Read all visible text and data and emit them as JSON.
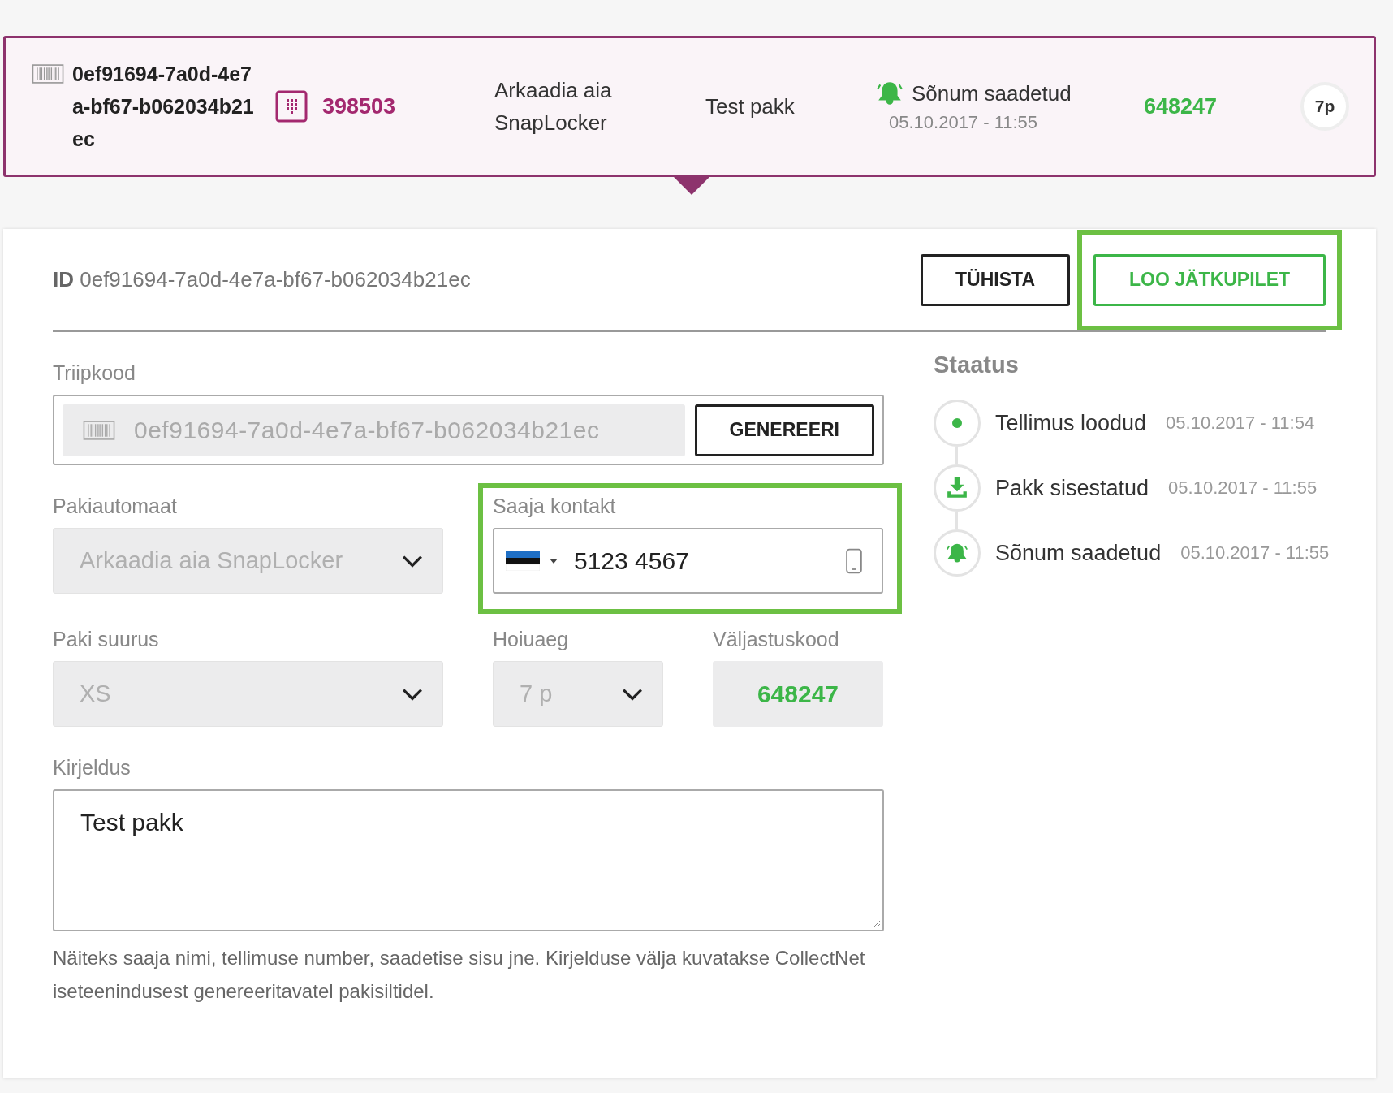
{
  "summary": {
    "barcode": "0ef91694-7a0d-4e7a-bf67-b062034b21ec",
    "pin": "398503",
    "locker": "Arkaadia aia SnapLocker",
    "description": "Test pakk",
    "status": "Sõnum saadetud",
    "status_time": "05.10.2017 - 11:55",
    "pickup_code": "648247",
    "storage_badge": "7p",
    "selected": true
  },
  "detail": {
    "id_label": "ID",
    "id": "0ef91694-7a0d-4e7a-bf67-b062034b21ec",
    "buttons": [
      {
        "label": "TÜHISTA",
        "kind": "outline",
        "highlighted": false
      },
      {
        "label": "LOO JÄTKUPILET",
        "kind": "primary",
        "highlighted": true
      }
    ],
    "barcode": {
      "label": "Triipkood",
      "value": "0ef91694-7a0d-4e7a-bf67-b062034b21ec",
      "button": "GENEREERI"
    },
    "locker": {
      "label": "Pakiautomaat",
      "value": "Arkaadia aia SnapLocker",
      "disabled": true
    },
    "contact": {
      "label": "Saaja kontakt",
      "value": "5123 4567",
      "highlighted": true
    },
    "size": {
      "label": "Paki suurus",
      "value": "XS",
      "disabled": true
    },
    "storage": {
      "label": "Hoiuaeg",
      "value": "7 p",
      "disabled": true
    },
    "pickup": {
      "label": "Väljastuskood",
      "value": "648247"
    },
    "description": {
      "label": "Kirjeldus",
      "value": "Test pakk",
      "help": "Näiteks saaja nimi, tellimuse number, saadetise sisu jne. Kirjelduse välja kuvatakse CollectNet iseteenindusest genereeritavatel pakisiltidel."
    },
    "status": {
      "title": "Staatus",
      "items": [
        {
          "kind": "dot",
          "label": "Tellimus loodud",
          "time": "05.10.2017 - 11:54"
        },
        {
          "kind": "download",
          "label": "Pakk sisestatud",
          "time": "05.10.2017 - 11:55"
        },
        {
          "kind": "bell",
          "label": "Sõnum saadetud",
          "time": "05.10.2017 - 11:55"
        }
      ]
    }
  }
}
